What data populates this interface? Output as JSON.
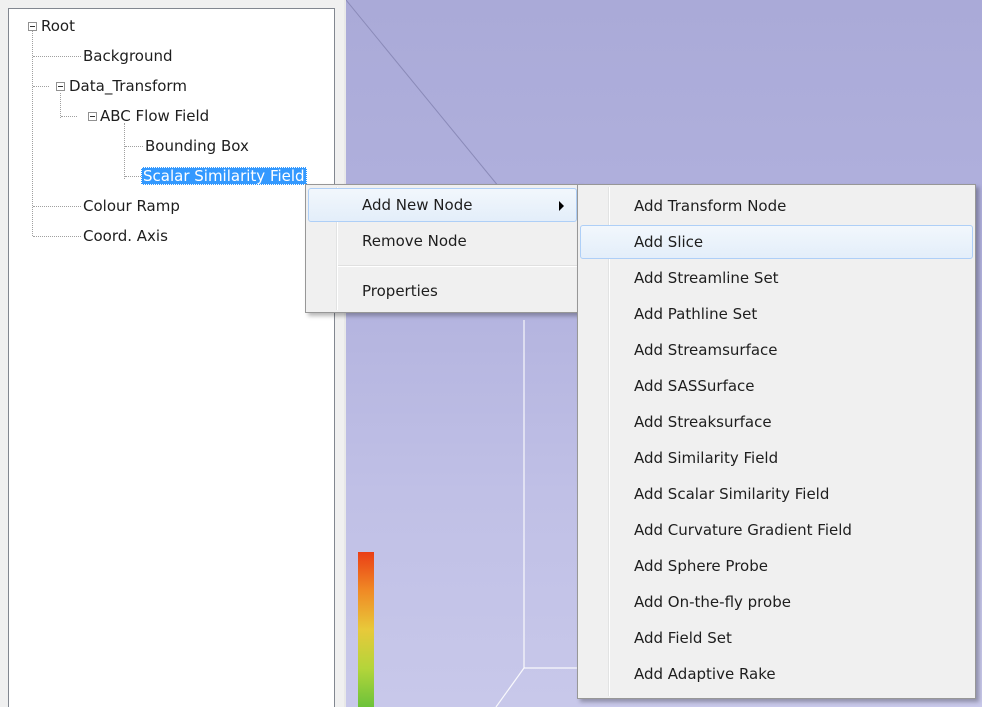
{
  "tree": {
    "nodes": [
      {
        "label": "Root",
        "expanded": true
      },
      {
        "label": "Background"
      },
      {
        "label": "Data_Transform",
        "expanded": true
      },
      {
        "label": "ABC Flow Field",
        "expanded": true
      },
      {
        "label": "Bounding Box"
      },
      {
        "label": "Scalar Similarity Field",
        "selected": true
      },
      {
        "label": "Colour Ramp"
      },
      {
        "label": "Coord. Axis"
      }
    ]
  },
  "context_menu": {
    "items": [
      {
        "label": "Add New Node",
        "has_submenu": true
      },
      {
        "label": "Remove Node"
      },
      {
        "label": "Properties"
      }
    ]
  },
  "submenu": {
    "items": [
      {
        "label": "Add Transform Node"
      },
      {
        "label": "Add Slice",
        "highlighted": true
      },
      {
        "label": "Add Streamline Set"
      },
      {
        "label": "Add Pathline Set"
      },
      {
        "label": "Add Streamsurface"
      },
      {
        "label": "Add SASSurface"
      },
      {
        "label": "Add Streaksurface"
      },
      {
        "label": "Add Similarity Field"
      },
      {
        "label": "Add Scalar Similarity Field"
      },
      {
        "label": "Add Curvature Gradient Field"
      },
      {
        "label": "Add Sphere Probe"
      },
      {
        "label": "Add On-the-fly probe"
      },
      {
        "label": "Add Field Set"
      },
      {
        "label": "Add Adaptive Rake"
      }
    ]
  },
  "colors": {
    "selection": "#3399ff",
    "viewport_top": "#aaaad8",
    "viewport_bottom": "#c8c8ea",
    "colorbar": [
      "#ea3e16",
      "#f08a25",
      "#e8c93a",
      "#b4d53a",
      "#6cc23a"
    ]
  }
}
